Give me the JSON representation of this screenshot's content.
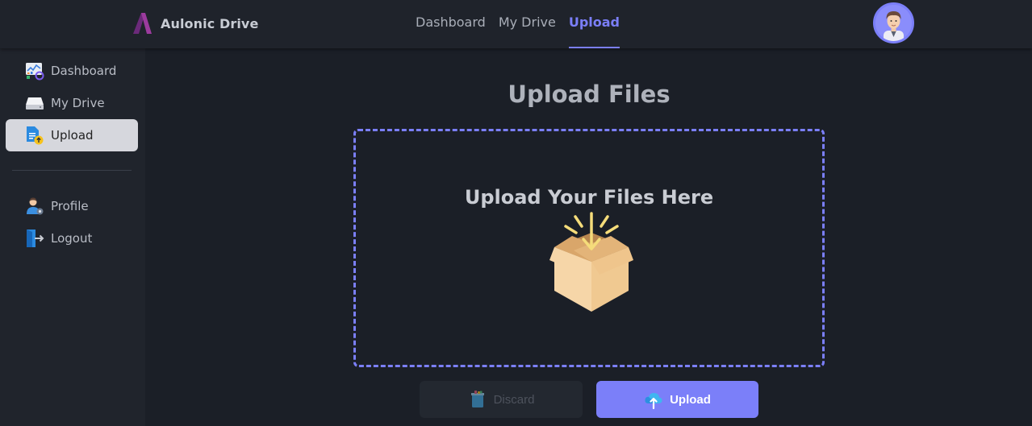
{
  "app": {
    "name": "Aulonic Drive"
  },
  "topnav": {
    "items": [
      {
        "label": "Dashboard",
        "active": false
      },
      {
        "label": "My Drive",
        "active": false
      },
      {
        "label": "Upload",
        "active": true
      }
    ]
  },
  "sidebar": {
    "items": [
      {
        "label": "Dashboard",
        "icon": "dashboard-chart-icon",
        "active": false
      },
      {
        "label": "My Drive",
        "icon": "hard-drive-icon",
        "active": false
      },
      {
        "label": "Upload",
        "icon": "file-upload-icon",
        "active": true
      },
      {
        "label": "Profile",
        "icon": "user-settings-icon",
        "active": false
      },
      {
        "label": "Logout",
        "icon": "logout-icon",
        "active": false
      }
    ]
  },
  "main": {
    "title": "Upload Files",
    "dropzone_text": "Upload Your Files Here",
    "dropzone_icon": "open-box-icon",
    "discard_label": "Discard",
    "discard_icon": "trash-icon",
    "upload_label": "Upload",
    "upload_icon": "cloud-upload-icon"
  },
  "colors": {
    "accent": "#7b7ff9",
    "background": "#1b1f27",
    "sidebar": "#20242c",
    "topbar": "#1f232b"
  }
}
